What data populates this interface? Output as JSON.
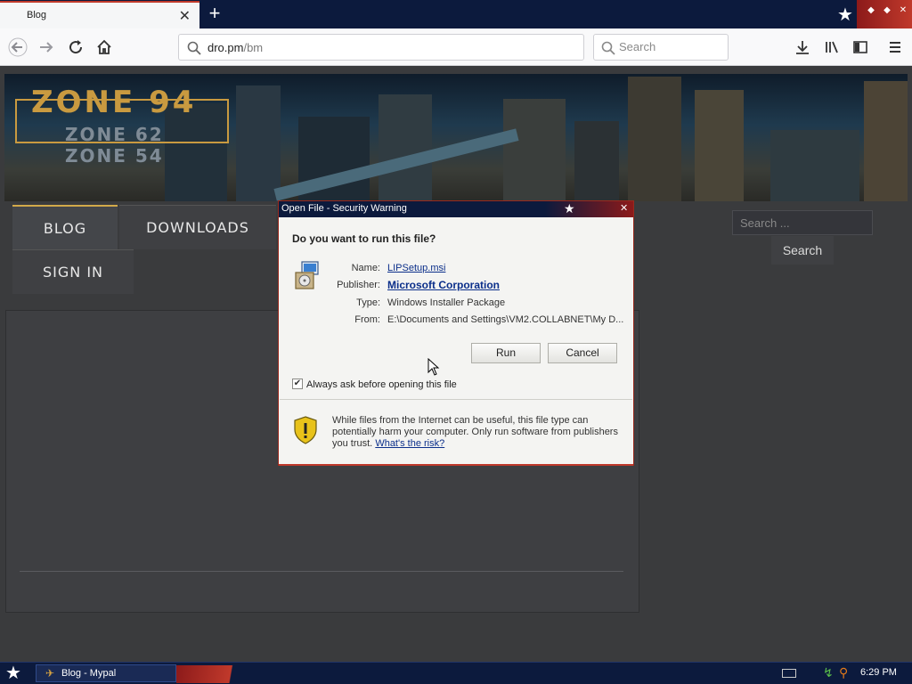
{
  "browser": {
    "tab_title": "Blog",
    "tab_close": "✕",
    "new_tab": "+",
    "url_host": "dro.pm",
    "url_path": "/bm",
    "search_placeholder": "Search"
  },
  "site": {
    "logo_main": "ZONE 94",
    "logo_sub1": "ZONE 62",
    "logo_sub2": "ZONE 54",
    "nav": {
      "blog": "BLOG",
      "downloads": "DOWNLOADS",
      "sign_in": "SIGN IN"
    },
    "search_placeholder": "Search ...",
    "search_button": "Search"
  },
  "dialog": {
    "title": "Open File - Security Warning",
    "question": "Do you want to run this file?",
    "name_label": "Name:",
    "name_value": "LIPSetup.msi",
    "publisher_label": "Publisher:",
    "publisher_value": "Microsoft Corporation",
    "type_label": "Type:",
    "type_value": "Windows Installer Package",
    "from_label": "From:",
    "from_value": "E:\\Documents and Settings\\VM2.COLLABNET\\My D...",
    "run_button": "Run",
    "cancel_button": "Cancel",
    "always_ask_label": "Always ask before opening this file",
    "always_ask_checked": true,
    "warning_text": "While files from the Internet can be useful, this file type can potentially harm your computer. Only run software from publishers you trust.",
    "risk_link": "What's the risk?"
  },
  "taskbar": {
    "task_label": "Blog - Mypal",
    "clock": "6:29 PM"
  },
  "colors": {
    "chrome_dark": "#0c1a3d",
    "accent_red": "#c0392b",
    "gold": "#c99a40",
    "link_blue": "#0b2f8a"
  }
}
